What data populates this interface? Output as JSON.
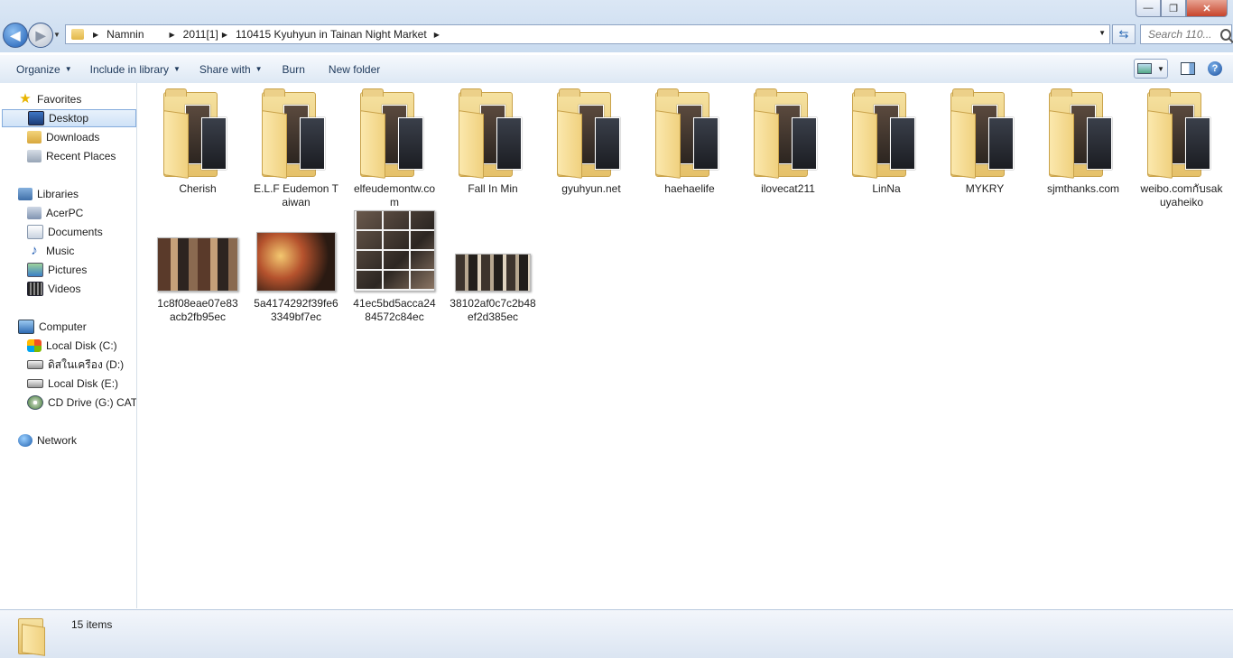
{
  "window": {
    "minimize": "—",
    "maximize": "❐",
    "close": "✕"
  },
  "address": {
    "crumbs": [
      "Namnin",
      "2011[1]",
      "110415 Kyuhyun in Tainan Night Market"
    ]
  },
  "search": {
    "placeholder": "Search 110..."
  },
  "toolbar": {
    "organize": "Organize",
    "include_in_library": "Include in library",
    "share_with": "Share with",
    "burn": "Burn",
    "new_folder": "New folder"
  },
  "nav": {
    "favorites": "Favorites",
    "desktop": "Desktop",
    "downloads": "Downloads",
    "recent_places": "Recent Places",
    "libraries": "Libraries",
    "acerpc": "AcerPC",
    "documents": "Documents",
    "music": "Music",
    "pictures": "Pictures",
    "videos": "Videos",
    "computer": "Computer",
    "disk_c": "Local Disk (C:)",
    "disk_d": "ดิสในเครือง (D:)",
    "disk_e": "Local Disk (E:)",
    "cd_g": "CD Drive (G:) CAT CD",
    "network": "Network"
  },
  "folders": [
    {
      "name": "Cherish"
    },
    {
      "name": "E.L.F Eudemon Taiwan"
    },
    {
      "name": "elfeudemontw.com"
    },
    {
      "name": "Fall In Min"
    },
    {
      "name": "gyuhyun.net"
    },
    {
      "name": "haehaelife"
    },
    {
      "name": "ilovecat211"
    },
    {
      "name": "LinNa"
    },
    {
      "name": "MYKRY"
    },
    {
      "name": "sjmthanks.com"
    },
    {
      "name": "weibo.comกับsakuyaheiko"
    }
  ],
  "images": [
    {
      "name": "1c8f08eae07e83acb2fb95ec"
    },
    {
      "name": "5a4174292f39fe63349bf7ec"
    },
    {
      "name": "41ec5bd5acca2484572c84ec"
    },
    {
      "name": "38102af0c7c2b48ef2d385ec"
    }
  ],
  "status": {
    "item_count": "15 items"
  }
}
